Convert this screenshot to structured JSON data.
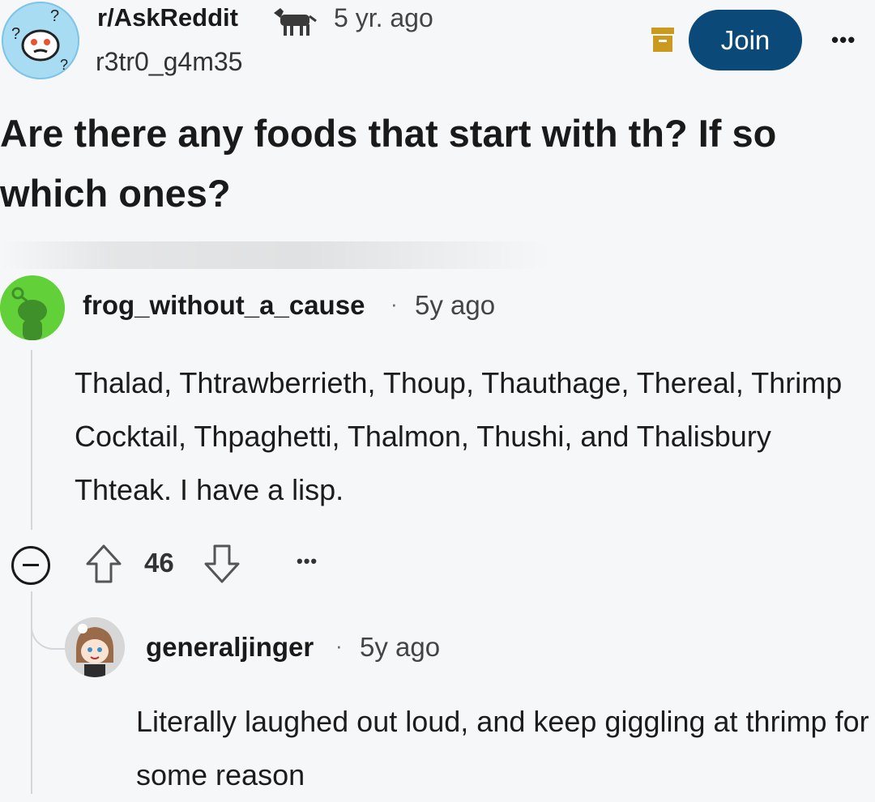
{
  "post": {
    "subreddit": "r/AskReddit",
    "time": "5 yr. ago",
    "author": "r3tr0_g4m35",
    "title": "Are there any foods that start with th? If so which ones?",
    "join_label": "Join",
    "more_label": "•••"
  },
  "comments": [
    {
      "author": "frog_without_a_cause",
      "separator": "·",
      "time": "5y ago",
      "body": "Thalad, Thtrawberrieth, Thoup, Thauthage, Thereal, Thrimp Cocktail, Thpaghetti, Thalmon, Thushi, and Thalisbury Thteak. I have a lisp.",
      "score": "46",
      "more_label": "•••"
    },
    {
      "author": "generaljinger",
      "separator": "·",
      "time": "5y ago",
      "body": "Literally laughed out loud, and keep giggling at thrimp for some reason"
    }
  ],
  "colors": {
    "background": "#f6f7f8",
    "join_button": "#0b4a78",
    "archive_icon": "#c99a1e",
    "op_avatar_bg": "#a8dcf2",
    "commenter_avatar_bg": "#62d038"
  },
  "icons": [
    "subreddit-avatar-icon",
    "donkey-flair-icon",
    "archive-icon",
    "upvote-icon",
    "downvote-icon",
    "collapse-icon",
    "snoo-avatar-icon",
    "anime-avatar-icon"
  ]
}
